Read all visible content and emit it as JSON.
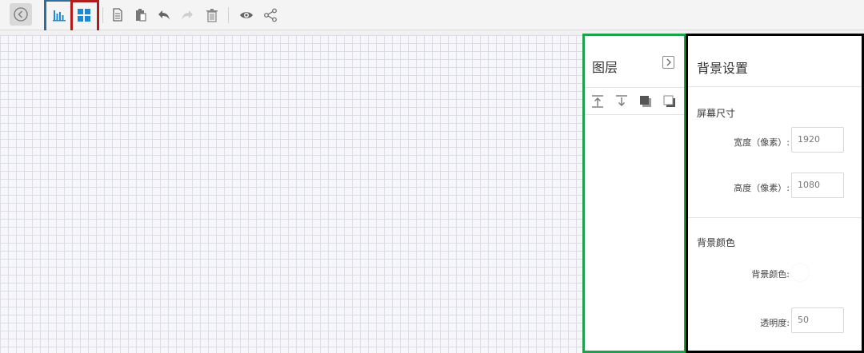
{
  "toolbar": {
    "icons": [
      "back-icon",
      "chart-icon",
      "component-grid-icon",
      "copy-icon",
      "paste-icon",
      "undo-icon",
      "redo-icon",
      "delete-icon",
      "preview-icon",
      "share-icon"
    ],
    "accent": "#1a8ad6"
  },
  "layers": {
    "title": "图层",
    "tools": [
      "move-to-top-icon",
      "move-to-bottom-icon",
      "bring-forward-icon",
      "send-backward-icon"
    ]
  },
  "background_settings": {
    "title": "背景设置",
    "screen_size": {
      "section_title": "屏幕尺寸",
      "width_label": "宽度（像素）:",
      "width_value": "1920",
      "height_label": "高度（像素）:",
      "height_value": "1080"
    },
    "background_color": {
      "section_title": "背景颜色",
      "color_label": "背景颜色:",
      "color_value": "#ffffff",
      "opacity_label": "透明度:",
      "opacity_value": "50"
    }
  },
  "highlight_colors": {
    "blue": "#2e6ea3",
    "red": "#b31b1b",
    "green": "#1fa04a",
    "black": "#000000"
  }
}
